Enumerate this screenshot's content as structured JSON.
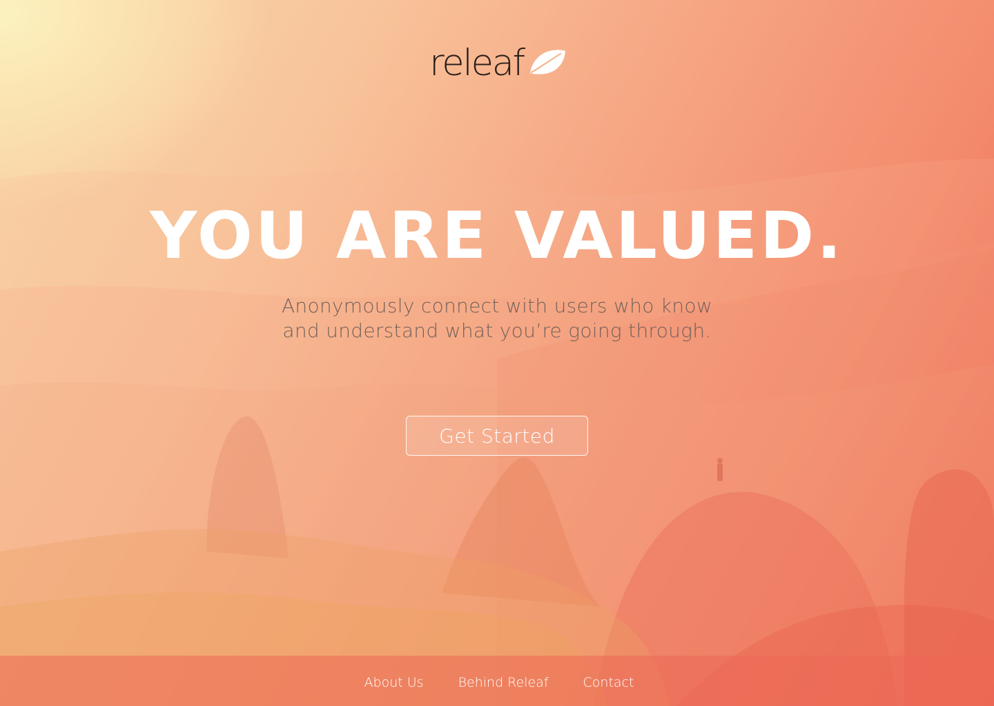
{
  "brand": {
    "name": "releaf",
    "logo_icon": "leaf-icon"
  },
  "hero": {
    "headline": "YOU ARE VALUED.",
    "subtitle_line1": "Anonymously connect with users who know",
    "subtitle_line2": "and understand what you’re going through.",
    "cta_label": "Get Started"
  },
  "footer": {
    "links": [
      {
        "label": "About Us"
      },
      {
        "label": "Behind Releaf"
      },
      {
        "label": "Contact"
      }
    ]
  },
  "colors": {
    "gradient_start": "#fbf2c0",
    "gradient_mid": "#f6a582",
    "gradient_end": "#ef5b48",
    "headline": "#ffffff",
    "subtitle": "#74615a",
    "brand_text": "#2a1f1b"
  }
}
